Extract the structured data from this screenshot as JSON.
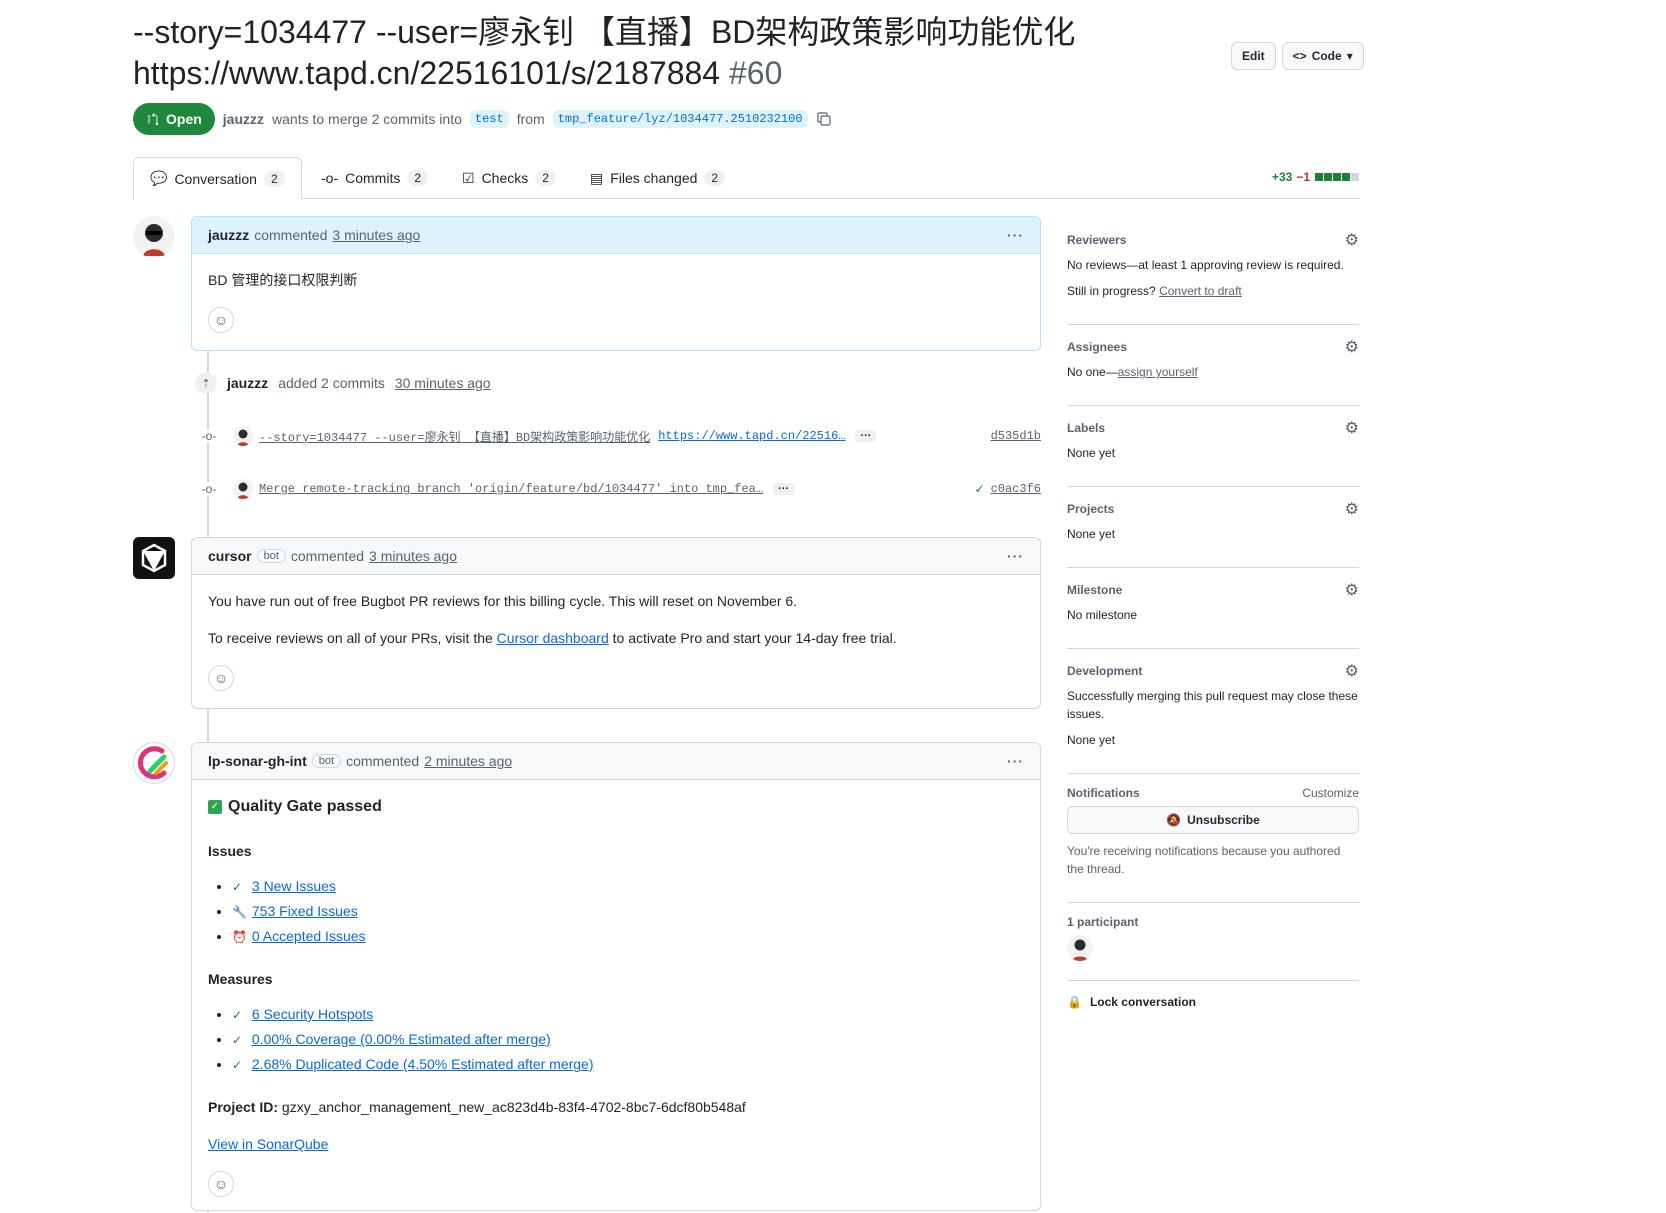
{
  "header": {
    "title": "--story=1034477 --user=廖永钊 【直播】BD架构政策影响功能优化 https://www.tapd.cn/22516101/s/2187884",
    "number": "#60",
    "edit_label": "Edit",
    "code_label": "Code",
    "state": "Open",
    "author": "jauzzz",
    "merge_text": "wants to merge 2 commits into",
    "base_branch": "test",
    "from_text": "from",
    "head_branch": "tmp_feature/lyz/1034477.2510232100"
  },
  "tabs": [
    {
      "label": "Conversation",
      "count": "2"
    },
    {
      "label": "Commits",
      "count": "2"
    },
    {
      "label": "Checks",
      "count": "2"
    },
    {
      "label": "Files changed",
      "count": "2"
    }
  ],
  "diffstat": {
    "additions": "+33",
    "deletions": "−1",
    "colors": [
      "#1a7f37",
      "#1a7f37",
      "#1a7f37",
      "#1a7f37",
      "#d1d9e0"
    ]
  },
  "comment1": {
    "author": "jauzzz",
    "action": "commented",
    "time": "3 minutes ago",
    "body": "BD 管理的接口权限判断"
  },
  "commits_event": {
    "author": "jauzzz",
    "action": "added 2 commits",
    "time": "30 minutes ago"
  },
  "commits": [
    {
      "message": "--story=1034477 --user=廖永钊 【直播】BD架构政策影响功能优化",
      "link": "https://www.tapd.cn/22516…",
      "sha": "d535d1b",
      "checked": false
    },
    {
      "message": "Merge remote-tracking branch 'origin/feature/bd/1034477' into tmp_fea…",
      "link": "",
      "sha": "c0ac3f6",
      "checked": true
    }
  ],
  "comment2": {
    "author": "cursor",
    "bot_label": "bot",
    "action": "commented",
    "time": "3 minutes ago",
    "para1": "You have run out of free Bugbot PR reviews for this billing cycle. This will reset on November 6.",
    "para2_pre": "To receive reviews on all of your PRs, visit the",
    "para2_link": "Cursor dashboard",
    "para2_post": "to activate Pro and start your 14-day free trial."
  },
  "comment3": {
    "author": "lp-sonar-gh-int",
    "bot_label": "bot",
    "action": "commented",
    "time": "2 minutes ago",
    "gate_title": "Quality Gate passed",
    "issues_heading": "Issues",
    "issues": [
      {
        "icon": "check-icon",
        "text": "3 New Issues"
      },
      {
        "icon": "wrench-icon",
        "text": "753 Fixed Issues"
      },
      {
        "icon": "clock-icon",
        "text": "0 Accepted Issues"
      }
    ],
    "measures_heading": "Measures",
    "measures": [
      {
        "icon": "check-icon",
        "text": "6 Security Hotspots"
      },
      {
        "icon": "check-icon",
        "text": "0.00% Coverage (0.00% Estimated after merge)"
      },
      {
        "icon": "check-icon",
        "text": "2.68% Duplicated Code (4.50% Estimated after merge)"
      }
    ],
    "project_label": "Project ID:",
    "project_id": "gzxy_anchor_management_new_ac823d4b-83f4-4702-8bc7-6dcf80b548af",
    "view_link": "View in SonarQube"
  },
  "sidebar": {
    "reviewers": {
      "title": "Reviewers",
      "line1": "No reviews—at least 1 approving review is required.",
      "line2_pre": "Still in progress?",
      "line2_link": "Convert to draft"
    },
    "assignees": {
      "title": "Assignees",
      "pre": "No one—",
      "link": "assign yourself"
    },
    "labels": {
      "title": "Labels",
      "value": "None yet"
    },
    "projects": {
      "title": "Projects",
      "value": "None yet"
    },
    "milestone": {
      "title": "Milestone",
      "value": "No milestone"
    },
    "development": {
      "title": "Development",
      "text": "Successfully merging this pull request may close these issues.",
      "value": "None yet"
    },
    "notifications": {
      "title": "Notifications",
      "customize": "Customize",
      "button": "Unsubscribe",
      "note": "You're receiving notifications because you authored the thread."
    },
    "participants": {
      "title": "1 participant"
    },
    "lock": "Lock conversation"
  }
}
